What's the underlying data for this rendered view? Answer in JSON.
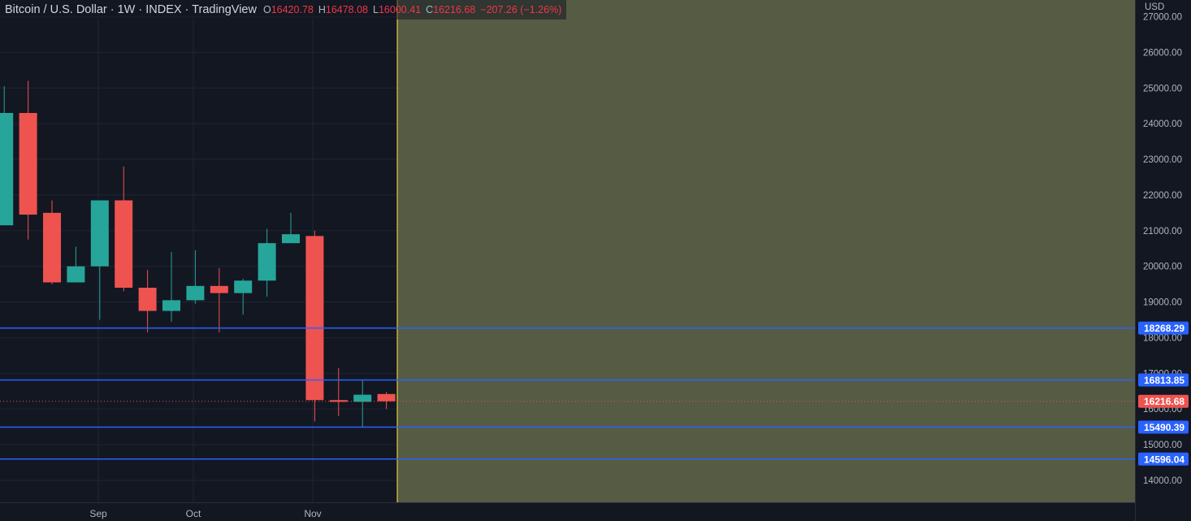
{
  "header": {
    "title": "Bitcoin / U.S. Dollar · 1W · INDEX · TradingView",
    "open_label": "O",
    "open": "16420.78",
    "high_label": "H",
    "high": "16478.08",
    "low_label": "L",
    "low": "16000.41",
    "close_label": "C",
    "close": "16216.68",
    "change": "−207.26 (−1.26%)"
  },
  "colors": {
    "background": "#131722",
    "up": "#26a69a",
    "down": "#ef5350",
    "level_line": "#2962ff",
    "forecast_zone": "#5a5f46",
    "divider": "#ffeb3b",
    "axis_text": "#b2b5be"
  },
  "chart_data": {
    "type": "candlestick",
    "currency_label": "USD",
    "y_ticks": [
      27000,
      26000,
      25000,
      24000,
      23000,
      22000,
      21000,
      20000,
      19000,
      18000,
      17000,
      16000,
      15000,
      14000
    ],
    "x_labels": [
      "Sep",
      "Oct",
      "Nov"
    ],
    "candles": [
      {
        "open": 21150,
        "high": 25050,
        "low": 22650,
        "close": 24300
      },
      {
        "open": 24300,
        "high": 25200,
        "low": 20750,
        "close": 21450
      },
      {
        "open": 21500,
        "high": 21850,
        "low": 19500,
        "close": 19550
      },
      {
        "open": 19550,
        "high": 20550,
        "low": 19550,
        "close": 20000
      },
      {
        "open": 20000,
        "high": 21850,
        "low": 18500,
        "close": 21850
      },
      {
        "open": 21850,
        "high": 22800,
        "low": 19300,
        "close": 19400
      },
      {
        "open": 19400,
        "high": 19900,
        "low": 18150,
        "close": 18750
      },
      {
        "open": 18750,
        "high": 20400,
        "low": 18450,
        "close": 19050
      },
      {
        "open": 19050,
        "high": 20450,
        "low": 18950,
        "close": 19450
      },
      {
        "open": 19450,
        "high": 19950,
        "low": 18150,
        "close": 19250
      },
      {
        "open": 19250,
        "high": 19650,
        "low": 18650,
        "close": 19600
      },
      {
        "open": 19600,
        "high": 21050,
        "low": 19150,
        "close": 20650
      },
      {
        "open": 20650,
        "high": 21500,
        "low": 20650,
        "close": 20900
      },
      {
        "open": 20850,
        "high": 21000,
        "low": 15650,
        "close": 16250
      },
      {
        "open": 16250,
        "high": 17150,
        "low": 15800,
        "close": 16200
      },
      {
        "open": 16200,
        "high": 16800,
        "low": 15500,
        "close": 16400
      },
      {
        "open": 16420.78,
        "high": 16478.08,
        "low": 16000.41,
        "close": 16216.68
      }
    ],
    "levels": [
      {
        "value": 18268.29,
        "label": "18268.29"
      },
      {
        "value": 16813.85,
        "label": "16813.85"
      },
      {
        "value": 15490.39,
        "label": "15490.39"
      },
      {
        "value": 14596.04,
        "label": "14596.04"
      }
    ],
    "last_price": {
      "value": 16216.68,
      "label": "16216.68"
    }
  }
}
